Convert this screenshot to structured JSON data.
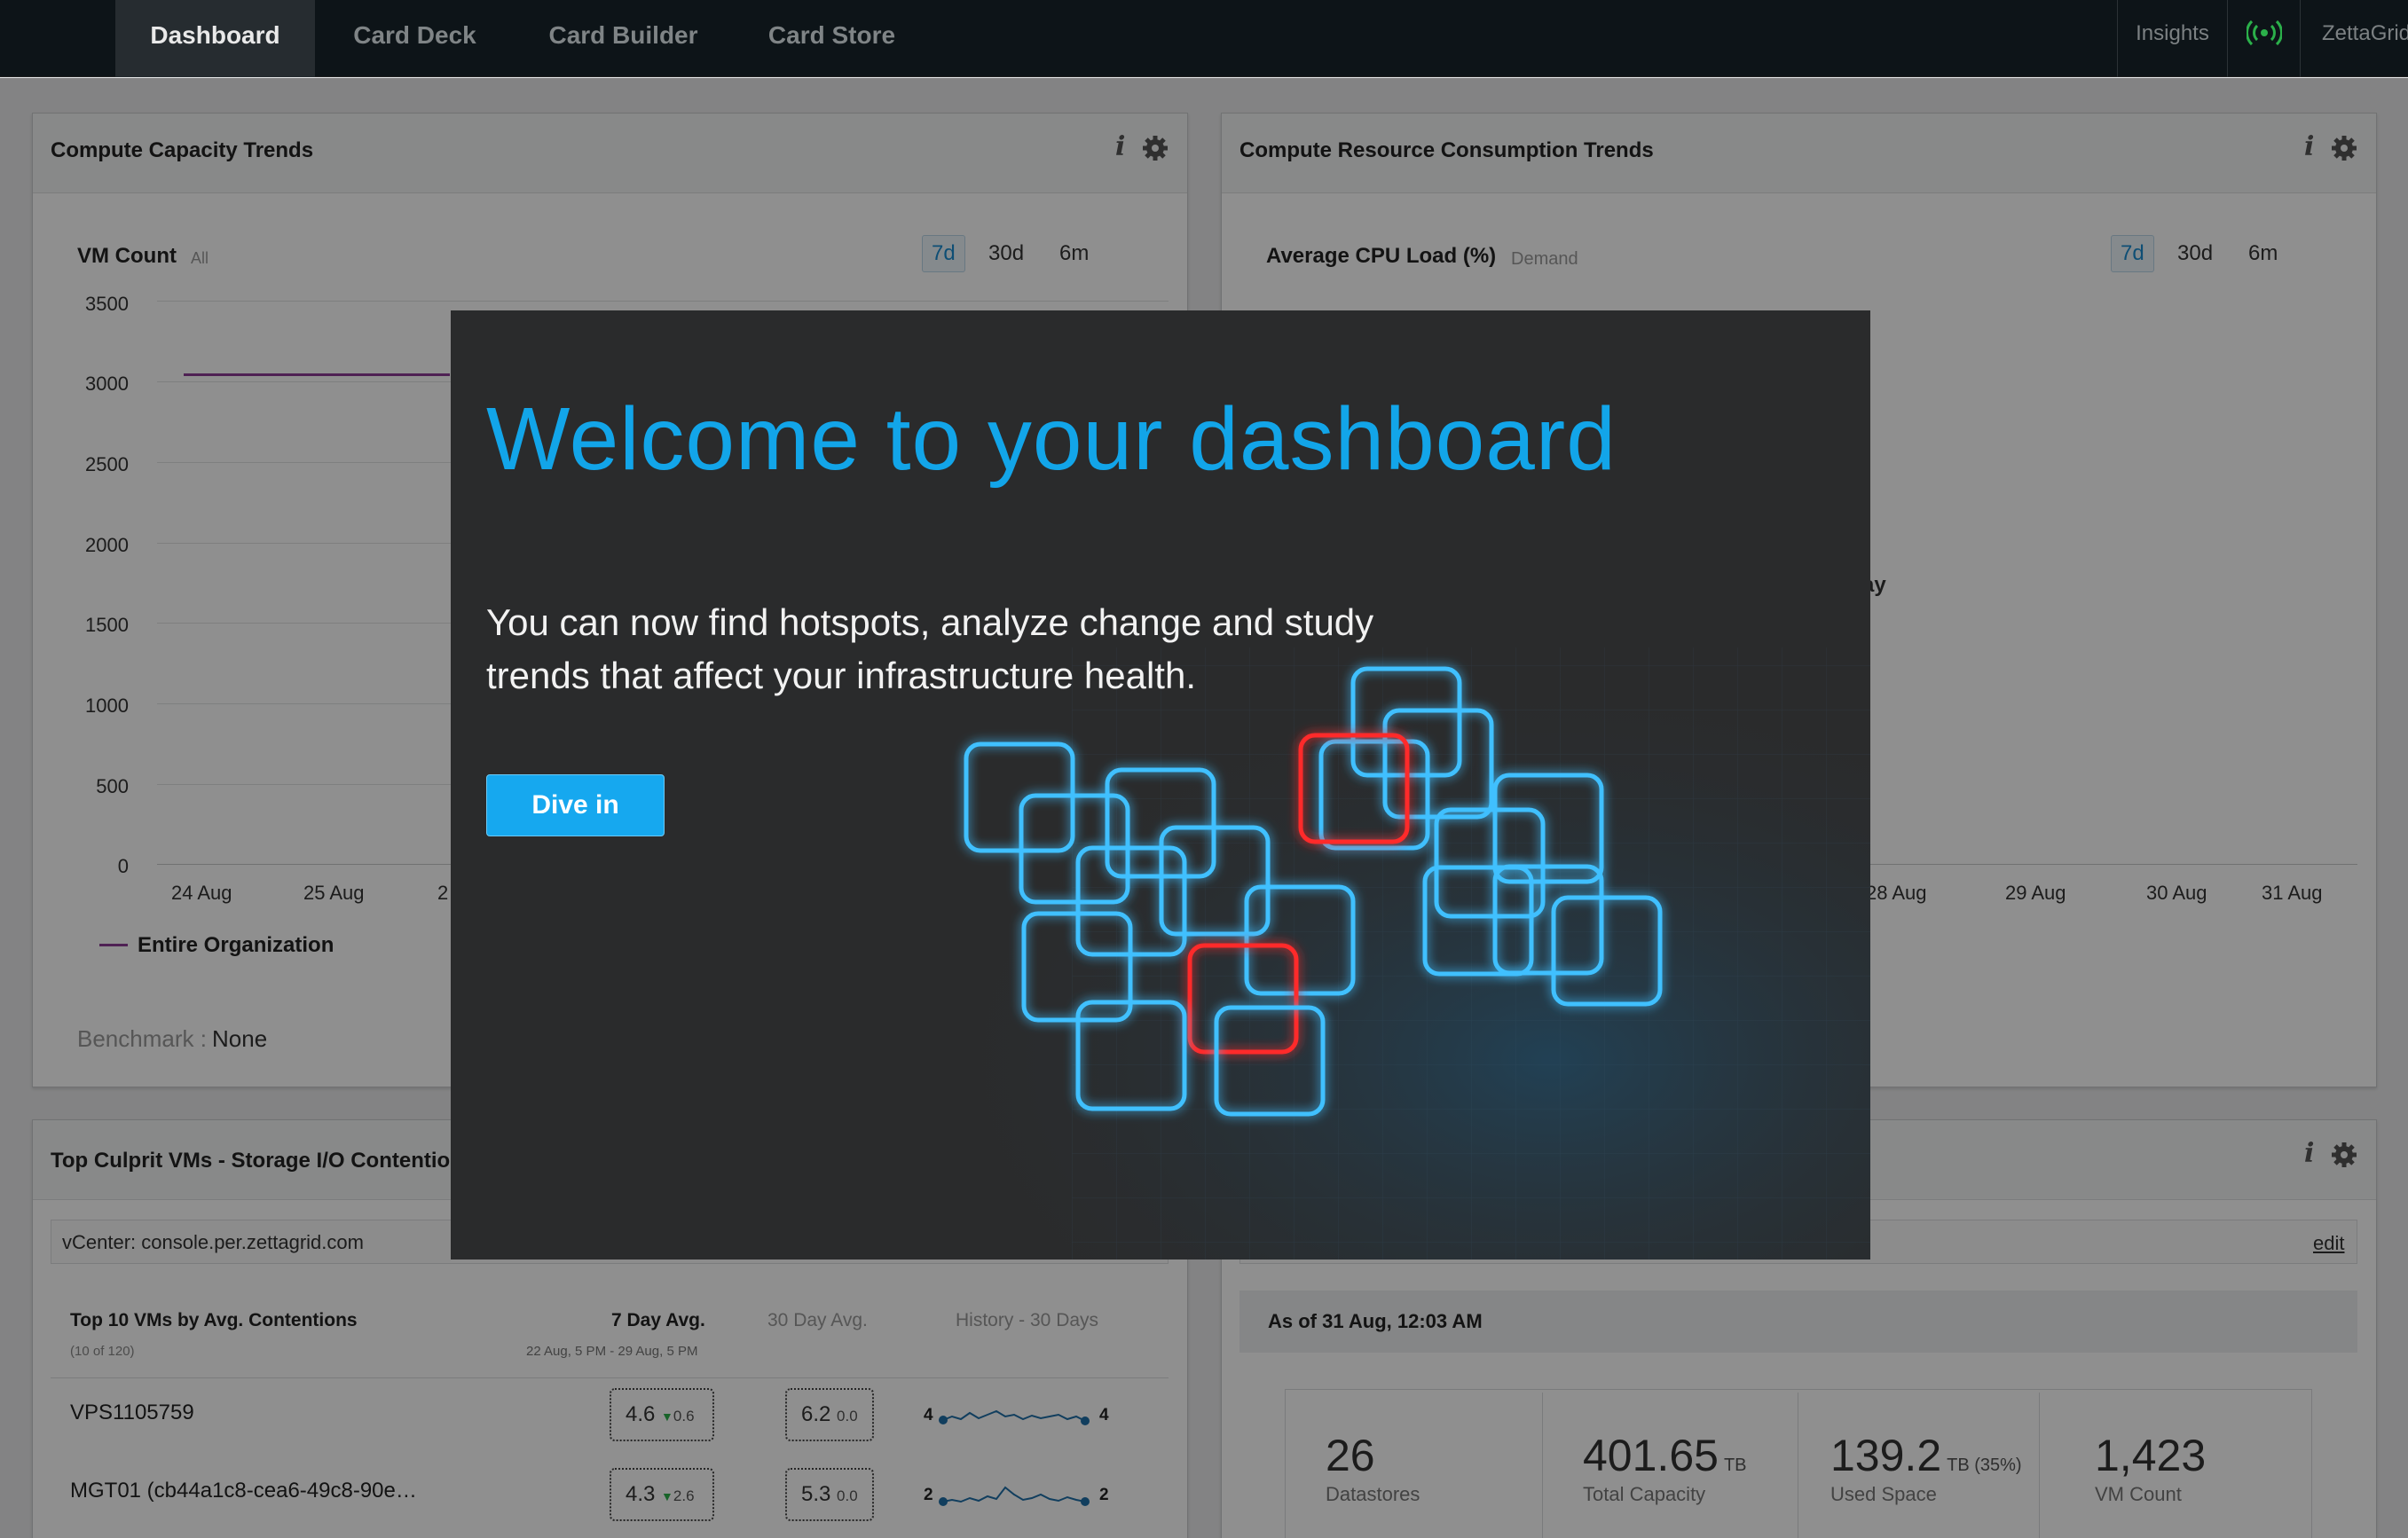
{
  "nav": {
    "tabs": [
      {
        "label": "Dashboard",
        "active": true
      },
      {
        "label": "Card Deck",
        "active": false
      },
      {
        "label": "Card Builder",
        "active": false
      },
      {
        "label": "Card Store",
        "active": false
      }
    ],
    "insights": "Insights",
    "org": "ZettaGrid"
  },
  "cards": {
    "capacity": {
      "title": "Compute Capacity Trends",
      "metric": "VM Count",
      "metric_sub": "All",
      "ranges": [
        "7d",
        "30d",
        "6m"
      ],
      "selected_range": "7d",
      "legend": "Entire Organization",
      "benchmark_label": "Benchmark :",
      "benchmark_value": "None",
      "x_partial": "2"
    },
    "consumption": {
      "title": "Compute Resource Consumption Trends",
      "metric": "Average CPU Load (%)",
      "metric_sub": "Demand",
      "ranges": [
        "7d",
        "30d",
        "6m"
      ],
      "selected_range": "7d",
      "peek_text": "ay",
      "x_labels": [
        "28 Aug",
        "29 Aug",
        "30 Aug",
        "31 Aug"
      ]
    },
    "culprit": {
      "title": "Top Culprit VMs - Storage I/O Contention",
      "vcenter": "vCenter: console.per.zettagrid.com",
      "table_title": "Top 10 VMs by Avg. Contentions",
      "table_sub": "(10 of 120)",
      "col_7day": "7 Day Avg.",
      "col_7day_range": "22 Aug, 5 PM - 29 Aug, 5 PM",
      "col_30day": "30 Day Avg.",
      "col_history": "History - 30 Days",
      "rows": [
        {
          "name": "VPS1105759",
          "avg7": "4.6",
          "delta7": "0.6",
          "avg30": "6.2",
          "delta30": "0.0",
          "hist_start": "4",
          "hist_end": "4"
        },
        {
          "name": "MGT01 (cb44a1c8-cea6-49c8-90e…",
          "avg7": "4.3",
          "delta7": "2.6",
          "avg30": "5.3",
          "delta30": "0.0",
          "hist_start": "2",
          "hist_end": "2"
        }
      ]
    },
    "storage": {
      "edit": "edit",
      "as_of": "As of 31 Aug, 12:03 AM",
      "stats": [
        {
          "value": "26",
          "unit": "",
          "label": "Datastores"
        },
        {
          "value": "401.65",
          "unit": "TB",
          "label": "Total Capacity"
        },
        {
          "value": "139.2",
          "unit": "TB (35%)",
          "label": "Used Space"
        },
        {
          "value": "1,423",
          "unit": "",
          "label": "VM Count"
        }
      ]
    }
  },
  "chart_data": {
    "type": "line",
    "ylim": [
      0,
      3500
    ],
    "y_ticks": [
      "3500",
      "3000",
      "2500",
      "2000",
      "1500",
      "1000",
      "500",
      "0"
    ],
    "categories": [
      "24 Aug",
      "25 Aug"
    ],
    "series": [
      {
        "name": "Entire Organization",
        "values": [
          3040,
          3040
        ],
        "color": "#8e3b96"
      }
    ]
  },
  "modal": {
    "title": "Welcome to your dashboard",
    "body": "You can now find hotspots, analyze change and study trends that affect your infrastructure health.",
    "button": "Dive in"
  },
  "colors": {
    "accent": "#12a5e9",
    "nav_bg": "#0d1418",
    "glow_blue": "#3fc0ff",
    "glow_red": "#ff2a2a",
    "connected": "#2bb04a"
  },
  "icons": {
    "info": "info-icon",
    "settings": "gear-icon",
    "broadcast": "broadcast-icon"
  }
}
